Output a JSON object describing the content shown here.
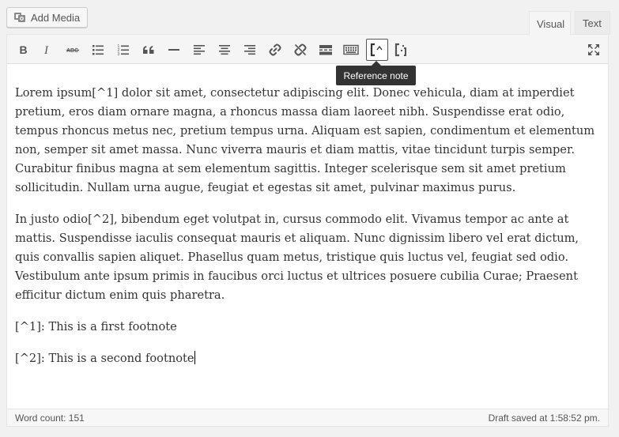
{
  "media": {
    "add_media_label": "Add Media"
  },
  "tabs": {
    "visual": "Visual",
    "text": "Text",
    "active": "Visual"
  },
  "toolbar": {
    "buttons": [
      {
        "icon": "bold-icon"
      },
      {
        "icon": "italic-icon"
      },
      {
        "icon": "strikethrough-icon"
      },
      {
        "icon": "bulleted-list-icon"
      },
      {
        "icon": "numbered-list-icon"
      },
      {
        "icon": "blockquote-icon"
      },
      {
        "icon": "horizontal-line-icon"
      },
      {
        "icon": "align-left-icon"
      },
      {
        "icon": "align-center-icon"
      },
      {
        "icon": "align-right-icon"
      },
      {
        "icon": "insert-link-icon"
      },
      {
        "icon": "remove-link-icon"
      },
      {
        "icon": "read-more-icon"
      },
      {
        "icon": "toolbar-toggle-icon"
      },
      {
        "icon": "reference-note-icon",
        "active": true
      },
      {
        "icon": "reference-note-alt-icon"
      },
      {
        "icon": "fullscreen-icon"
      }
    ],
    "tooltip": "Reference note"
  },
  "content": {
    "paragraphs": [
      "Lorem ipsum[^1] dolor sit amet, consectetur adipiscing elit. Donec vehicula, diam at imperdiet pretium, eros diam ornare magna, a rhoncus massa diam laoreet nibh. Suspendisse erat odio, tempus rhoncus metus nec, pretium tempus urna. Aliquam est sapien, condimentum et elementum non, semper sit amet massa. Nunc viverra mauris et diam mattis, vitae tincidunt turpis semper. Curabitur finibus magna at sem elementum sagittis. Integer scelerisque sem sit amet pretium sollicitudin. Nullam urna augue, feugiat et egestas sit amet, pulvinar maximus purus.",
      "In justo odio[^2], bibendum eget volutpat in, cursus commodo elit. Vivamus tempor ac ante at mattis. Suspendisse iaculis consequat mauris et aliquam. Nunc dignissim libero vel erat dictum, quis convallis sapien aliquet. Phasellus quam metus, tristique quis luctus vel, feugiat sed odio. Vestibulum ante ipsum primis in faucibus orci luctus et ultrices posuere cubilia Curae; Praesent efficitur dictum enim quis pharetra.",
      "[^1]: This is a first footnote",
      "[^2]: This is a second footnote"
    ]
  },
  "status": {
    "word_count": "Word count: 151",
    "draft_saved": "Draft saved at 1:58:52 pm."
  },
  "colors": {
    "background": "#f1f1f1",
    "toolbar_bg": "#f5f5f5",
    "icon": "#555555",
    "tooltip_bg": "#333333",
    "text": "#333333"
  }
}
